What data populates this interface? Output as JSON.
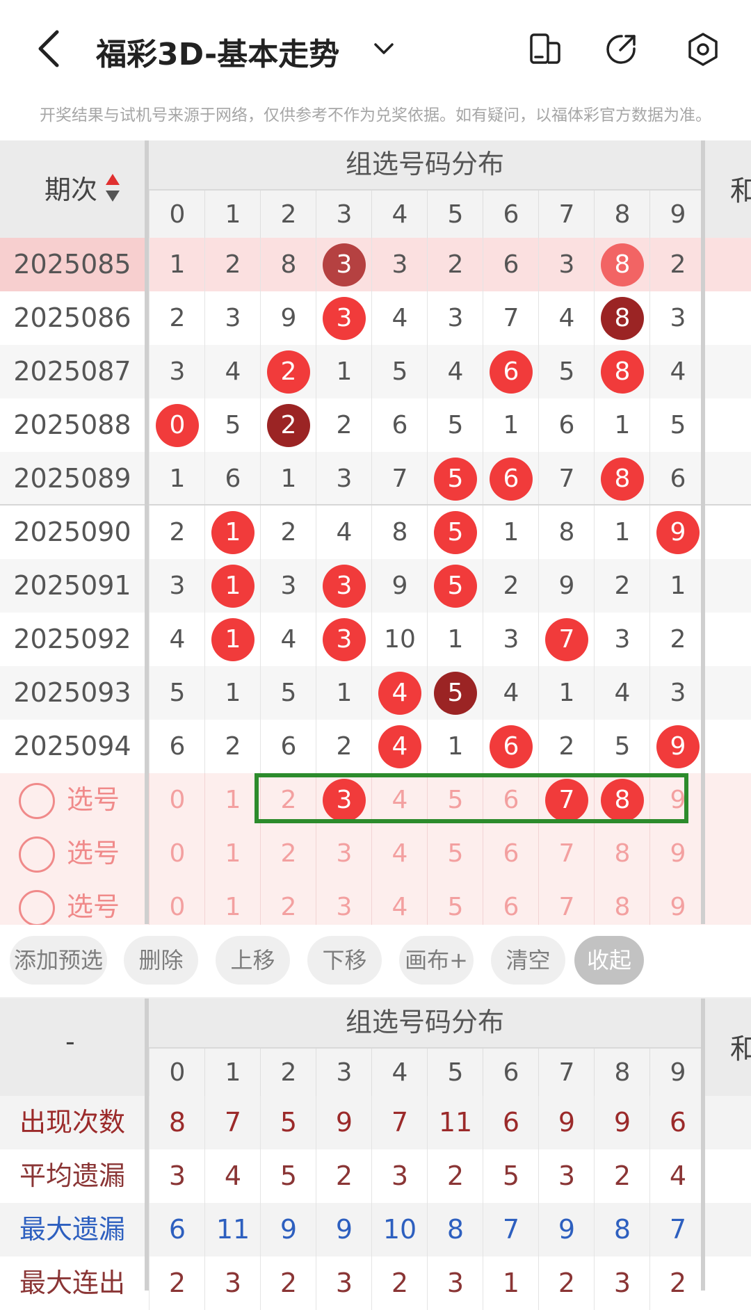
{
  "header": {
    "title": "福彩3D-基本走势",
    "icons": [
      "back-arrow-icon",
      "chevron-down-icon",
      "compare-pages-icon",
      "share-icon",
      "settings-icon"
    ]
  },
  "notice": "开奖结果与试机号来源于网络，仅供参考不作为兑奖依据。如有疑问，以福体彩官方数据为准。",
  "trend": {
    "period_label": "期次",
    "group_label": "组选号码分布",
    "right_label": "和",
    "digits": [
      "0",
      "1",
      "2",
      "3",
      "4",
      "5",
      "6",
      "7",
      "8",
      "9"
    ],
    "rows": [
      {
        "issue": "2025085",
        "cells": [
          "1",
          "2",
          "8",
          "3",
          "3",
          "2",
          "6",
          "3",
          "8",
          "2"
        ],
        "balls": [
          {
            "i": 3,
            "s": "muted"
          },
          {
            "i": 8,
            "s": "soft"
          }
        ],
        "highlight": true
      },
      {
        "issue": "2025086",
        "cells": [
          "2",
          "3",
          "9",
          "3",
          "4",
          "3",
          "7",
          "4",
          "8",
          "3"
        ],
        "balls": [
          {
            "i": 3,
            "s": "red"
          },
          {
            "i": 8,
            "s": "dark"
          }
        ]
      },
      {
        "issue": "2025087",
        "cells": [
          "3",
          "4",
          "2",
          "1",
          "5",
          "4",
          "6",
          "5",
          "8",
          "4"
        ],
        "balls": [
          {
            "i": 2,
            "s": "red"
          },
          {
            "i": 6,
            "s": "red"
          },
          {
            "i": 8,
            "s": "red"
          }
        ]
      },
      {
        "issue": "2025088",
        "cells": [
          "0",
          "5",
          "2",
          "2",
          "6",
          "5",
          "1",
          "6",
          "1",
          "5"
        ],
        "balls": [
          {
            "i": 0,
            "s": "red"
          },
          {
            "i": 2,
            "s": "dark"
          }
        ]
      },
      {
        "issue": "2025089",
        "cells": [
          "1",
          "6",
          "1",
          "3",
          "7",
          "5",
          "6",
          "7",
          "8",
          "6"
        ],
        "balls": [
          {
            "i": 5,
            "s": "red"
          },
          {
            "i": 6,
            "s": "red"
          },
          {
            "i": 8,
            "s": "red"
          }
        ]
      },
      {
        "issue": "2025090",
        "cells": [
          "2",
          "1",
          "2",
          "4",
          "8",
          "5",
          "1",
          "8",
          "1",
          "9"
        ],
        "balls": [
          {
            "i": 1,
            "s": "red"
          },
          {
            "i": 5,
            "s": "red"
          },
          {
            "i": 9,
            "s": "red"
          }
        ]
      },
      {
        "issue": "2025091",
        "cells": [
          "3",
          "1",
          "3",
          "3",
          "9",
          "5",
          "2",
          "9",
          "2",
          "1"
        ],
        "balls": [
          {
            "i": 1,
            "s": "red"
          },
          {
            "i": 3,
            "s": "red"
          },
          {
            "i": 5,
            "s": "red"
          }
        ]
      },
      {
        "issue": "2025092",
        "cells": [
          "4",
          "1",
          "4",
          "3",
          "10",
          "1",
          "3",
          "7",
          "3",
          "2"
        ],
        "balls": [
          {
            "i": 1,
            "s": "red"
          },
          {
            "i": 3,
            "s": "red"
          },
          {
            "i": 7,
            "s": "red"
          }
        ]
      },
      {
        "issue": "2025093",
        "cells": [
          "5",
          "1",
          "5",
          "1",
          "4",
          "5",
          "4",
          "1",
          "4",
          "3"
        ],
        "balls": [
          {
            "i": 4,
            "s": "red"
          },
          {
            "i": 5,
            "s": "dark"
          }
        ]
      },
      {
        "issue": "2025094",
        "cells": [
          "6",
          "2",
          "6",
          "2",
          "4",
          "1",
          "6",
          "2",
          "5",
          "9"
        ],
        "balls": [
          {
            "i": 4,
            "s": "red"
          },
          {
            "i": 6,
            "s": "red"
          },
          {
            "i": 9,
            "s": "red"
          }
        ]
      }
    ],
    "select_rows": [
      {
        "label": "选号",
        "selected": [
          3,
          7,
          8
        ]
      },
      {
        "label": "选号",
        "selected": []
      },
      {
        "label": "选号",
        "selected": []
      }
    ]
  },
  "actions": [
    "添加预选",
    "删除",
    "上移",
    "下移",
    "画布+",
    "清空",
    "收起"
  ],
  "stats": {
    "corner_label": "-",
    "group_label": "组选号码分布",
    "right_label": "和",
    "rows": [
      {
        "label": "出现次数",
        "color": "#9b2a2a",
        "values": [
          "8",
          "7",
          "5",
          "9",
          "7",
          "11",
          "6",
          "9",
          "9",
          "6"
        ]
      },
      {
        "label": "平均遗漏",
        "color": "#8a3535",
        "values": [
          "3",
          "4",
          "5",
          "2",
          "3",
          "2",
          "5",
          "3",
          "2",
          "4"
        ]
      },
      {
        "label": "最大遗漏",
        "color": "#2d5fbf",
        "values": [
          "6",
          "11",
          "9",
          "9",
          "10",
          "8",
          "7",
          "9",
          "8",
          "7"
        ]
      },
      {
        "label": "最大连出",
        "color": "#8a3535",
        "values": [
          "2",
          "3",
          "2",
          "3",
          "2",
          "3",
          "1",
          "2",
          "3",
          "2"
        ]
      }
    ]
  },
  "colors": {
    "ball_red": "#f13b3b",
    "ball_dark": "#9b2424",
    "highlight_row": "#fbe0e0",
    "select_bg": "#fdeeed",
    "green_frame": "#2c8b2c"
  }
}
